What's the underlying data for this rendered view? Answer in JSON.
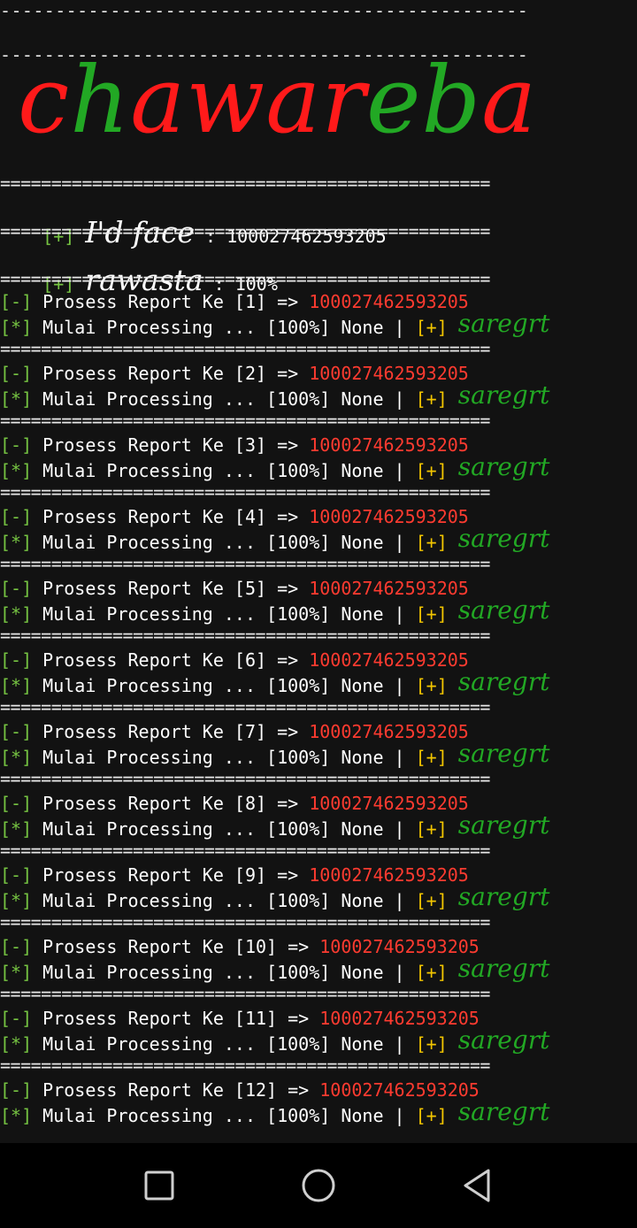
{
  "banner": {
    "part1": "c",
    "part2": "h",
    "part3": "awar",
    "part4": "eb",
    "part5": "a"
  },
  "dashes": "------------------------------------------------",
  "equals": "================================================",
  "info": [
    {
      "tag": "[+]",
      "label": "I'd face",
      "sep": " : ",
      "value": "100027462593205"
    },
    {
      "tag": "[+]",
      "label": "rawasta",
      "sep": " : ",
      "value": "100%"
    }
  ],
  "reports": [
    {
      "prefix": "[-]",
      "text": " Prosess Report Ke [1] => ",
      "id": "100027462593205",
      "star": "[*]",
      "status": " Mulai Processing ... [100%] None | ",
      "plus": "[+]",
      "sig": "saregrt"
    },
    {
      "prefix": "[-]",
      "text": " Prosess Report Ke [2] => ",
      "id": "100027462593205",
      "star": "[*]",
      "status": " Mulai Processing ... [100%] None | ",
      "plus": "[+]",
      "sig": "saregrt"
    },
    {
      "prefix": "[-]",
      "text": " Prosess Report Ke [3] => ",
      "id": "100027462593205",
      "star": "[*]",
      "status": " Mulai Processing ... [100%] None | ",
      "plus": "[+]",
      "sig": "saregrt"
    },
    {
      "prefix": "[-]",
      "text": " Prosess Report Ke [4] => ",
      "id": "100027462593205",
      "star": "[*]",
      "status": " Mulai Processing ... [100%] None | ",
      "plus": "[+]",
      "sig": "saregrt"
    },
    {
      "prefix": "[-]",
      "text": " Prosess Report Ke [5] => ",
      "id": "100027462593205",
      "star": "[*]",
      "status": " Mulai Processing ... [100%] None | ",
      "plus": "[+]",
      "sig": "saregrt"
    },
    {
      "prefix": "[-]",
      "text": " Prosess Report Ke [6] => ",
      "id": "100027462593205",
      "star": "[*]",
      "status": " Mulai Processing ... [100%] None | ",
      "plus": "[+]",
      "sig": "saregrt"
    },
    {
      "prefix": "[-]",
      "text": " Prosess Report Ke [7] => ",
      "id": "100027462593205",
      "star": "[*]",
      "status": " Mulai Processing ... [100%] None | ",
      "plus": "[+]",
      "sig": "saregrt"
    },
    {
      "prefix": "[-]",
      "text": " Prosess Report Ke [8] => ",
      "id": "100027462593205",
      "star": "[*]",
      "status": " Mulai Processing ... [100%] None | ",
      "plus": "[+]",
      "sig": "saregrt"
    },
    {
      "prefix": "[-]",
      "text": " Prosess Report Ke [9] => ",
      "id": "100027462593205",
      "star": "[*]",
      "status": " Mulai Processing ... [100%] None | ",
      "plus": "[+]",
      "sig": "saregrt"
    },
    {
      "prefix": "[-]",
      "text": " Prosess Report Ke [10] => ",
      "id": "100027462593205",
      "star": "[*]",
      "status": " Mulai Processing ... [100%] None | ",
      "plus": "[+]",
      "sig": "saregrt"
    },
    {
      "prefix": "[-]",
      "text": " Prosess Report Ke [11] => ",
      "id": "100027462593205",
      "star": "[*]",
      "status": " Mulai Processing ... [100%] None | ",
      "plus": "[+]",
      "sig": "saregrt"
    },
    {
      "prefix": "[-]",
      "text": " Prosess Report Ke [12] => ",
      "id": "100027462593205",
      "star": "[*]",
      "status": " Mulai Processing ... [100%] None | ",
      "plus": "[+]",
      "sig": "saregrt"
    }
  ],
  "navbar": {
    "recents": "square-icon",
    "home": "circle-icon",
    "back": "triangle-back-icon"
  },
  "colors": {
    "background": "#121212",
    "bracket_green": "#76c442",
    "bracket_yellow": "#f2c500",
    "id_red": "#ff3b30",
    "script_green": "#22a824",
    "banner_red": "#ff1a1a"
  }
}
